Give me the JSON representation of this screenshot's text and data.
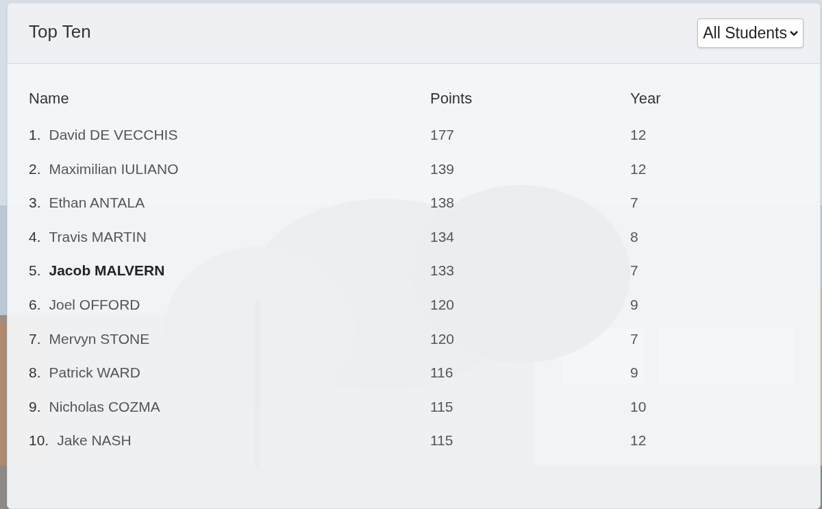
{
  "card": {
    "title": "Top Ten",
    "filter": {
      "value": "All Students"
    }
  },
  "table": {
    "columns": [
      "Name",
      "Points",
      "Year"
    ],
    "rows": [
      {
        "rank": "1.",
        "name": "David DE VECCHIS",
        "points": "177",
        "year": "12",
        "highlighted": false
      },
      {
        "rank": "2.",
        "name": "Maximilian IULIANO",
        "points": "139",
        "year": "12",
        "highlighted": false
      },
      {
        "rank": "3.",
        "name": "Ethan ANTALA",
        "points": "138",
        "year": "7",
        "highlighted": false
      },
      {
        "rank": "4.",
        "name": "Travis MARTIN",
        "points": "134",
        "year": "8",
        "highlighted": false
      },
      {
        "rank": "5.",
        "name": "Jacob MALVERN",
        "points": "133",
        "year": "7",
        "highlighted": true
      },
      {
        "rank": "6.",
        "name": "Joel OFFORD",
        "points": "120",
        "year": "9",
        "highlighted": false
      },
      {
        "rank": "7.",
        "name": "Mervyn STONE",
        "points": "120",
        "year": "7",
        "highlighted": false
      },
      {
        "rank": "8.",
        "name": "Patrick WARD",
        "points": "116",
        "year": "9",
        "highlighted": false
      },
      {
        "rank": "9.",
        "name": "Nicholas COZMA",
        "points": "115",
        "year": "10",
        "highlighted": false
      },
      {
        "rank": "10.",
        "name": "Jake NASH",
        "points": "115",
        "year": "12",
        "highlighted": false
      }
    ]
  }
}
